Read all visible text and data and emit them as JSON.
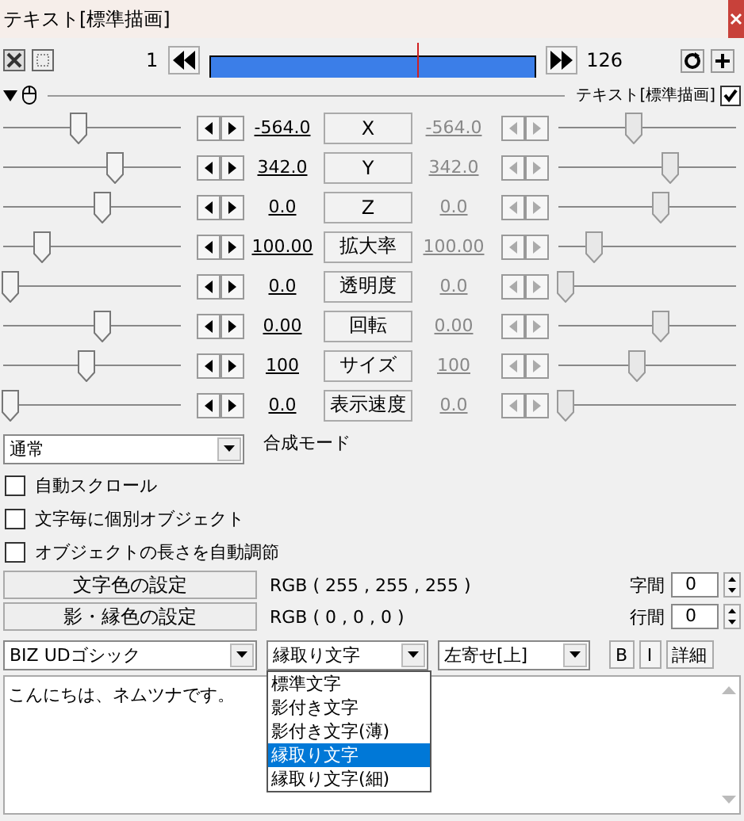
{
  "window": {
    "title": "テキスト[標準描画]"
  },
  "timeline": {
    "start": "1",
    "end": "126",
    "level": 0.64
  },
  "header": {
    "label": "テキスト[標準描画]",
    "checked": true
  },
  "tracks": [
    {
      "name": "X",
      "value": "-564.0",
      "end_value": "-564.0",
      "start_slider": {
        "level": 0.38
      },
      "end_slider": {
        "level": 0.38
      }
    },
    {
      "name": "Y",
      "value": "342.0",
      "end_value": "342.0",
      "start_slider": {
        "level": 0.59
      },
      "end_slider": {
        "level": 0.59
      }
    },
    {
      "name": "Z",
      "value": "0.0",
      "end_value": "0.0",
      "start_slider": {
        "level": 0.52
      },
      "end_slider": {
        "level": 0.54
      }
    },
    {
      "name": "拡大率",
      "value": "100.00",
      "end_value": "100.00",
      "start_slider": {
        "level": 0.18
      },
      "end_slider": {
        "level": 0.16
      }
    },
    {
      "name": "透明度",
      "value": "0.0",
      "end_value": "0.0",
      "start_slider": {
        "level": 0
      },
      "end_slider": {
        "level": 0
      }
    },
    {
      "name": "回転",
      "value": "0.00",
      "end_value": "0.00",
      "start_slider": {
        "level": 0.52
      },
      "end_slider": {
        "level": 0.54
      }
    },
    {
      "name": "サイズ",
      "value": "100",
      "end_value": "100",
      "start_slider": {
        "level": 0.43
      },
      "end_slider": {
        "level": 0.4
      }
    },
    {
      "name": "表示速度",
      "value": "0.0",
      "end_value": "0.0",
      "start_slider": {
        "level": 0
      },
      "end_slider": {
        "level": 0
      }
    }
  ],
  "blend": {
    "value": "通常",
    "label": "合成モード"
  },
  "options": [
    {
      "label": "自動スクロール",
      "checked": false
    },
    {
      "label": "文字毎に個別オブジェクト",
      "checked": false
    },
    {
      "label": "オブジェクトの長さを自動調節",
      "checked": false
    }
  ],
  "colors": [
    {
      "button": "文字色の設定",
      "value": "RGB ( 255 , 255 , 255 )",
      "spin_label": "字間",
      "spin_value": "0"
    },
    {
      "button": "影・縁色の設定",
      "value": "RGB ( 0 , 0 , 0 )",
      "spin_label": "行間",
      "spin_value": "0"
    }
  ],
  "font": {
    "value": "BIZ UDゴシック"
  },
  "style": {
    "value": "縁取り文字",
    "options": [
      {
        "label": "標準文字",
        "selected": false
      },
      {
        "label": "影付き文字",
        "selected": false
      },
      {
        "label": "影付き文字(薄)",
        "selected": false
      },
      {
        "label": "縁取り文字",
        "selected": true
      },
      {
        "label": "縁取り文字(細)",
        "selected": false
      }
    ]
  },
  "align": {
    "value": "左寄せ[上]"
  },
  "buttons": [
    "B",
    "I",
    "詳細"
  ],
  "text": {
    "value": "こんにちは、ネムツナです。"
  }
}
